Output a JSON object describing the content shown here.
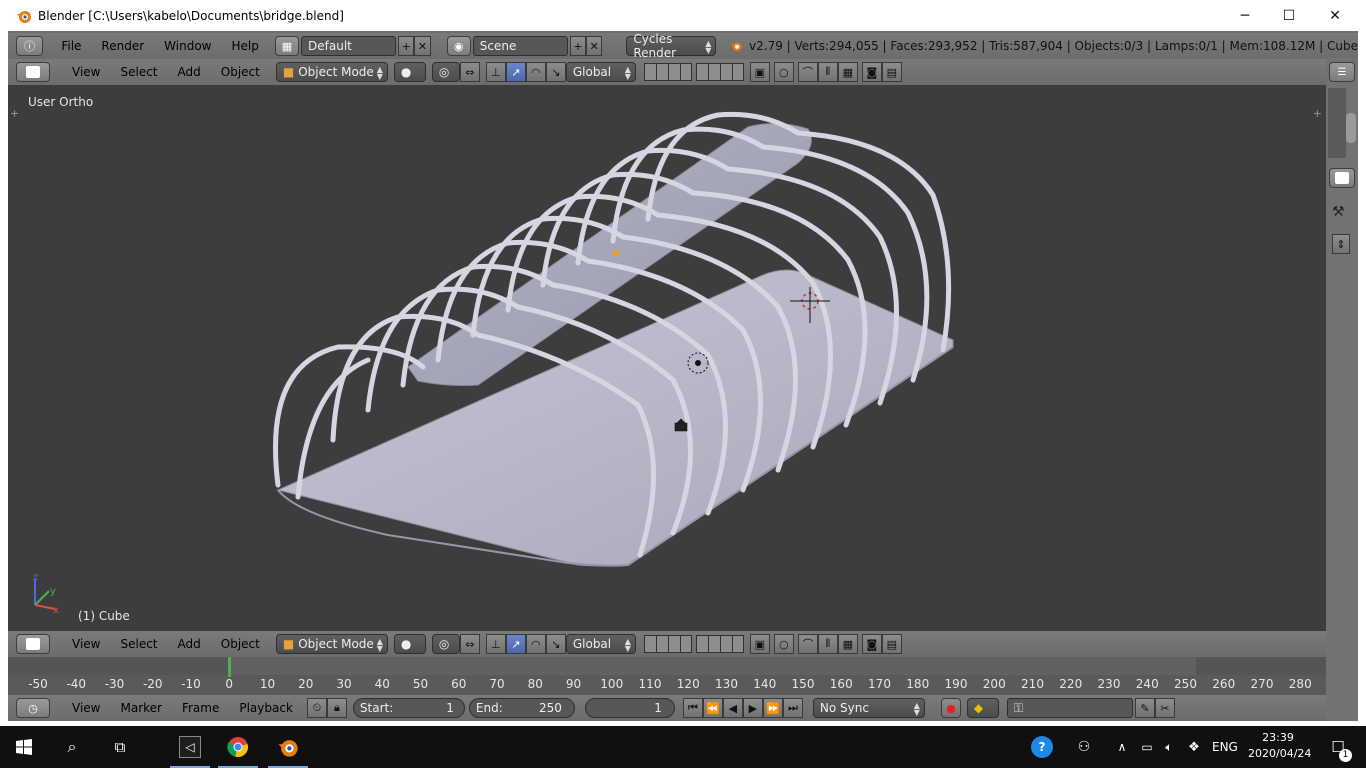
{
  "window": {
    "title": "Blender [C:\\Users\\kabelo\\Documents\\bridge.blend]",
    "minimize_glyph": "─",
    "maximize_glyph": "☐",
    "close_glyph": "✕"
  },
  "info_header": {
    "menus": [
      "File",
      "Render",
      "Window",
      "Help"
    ],
    "screen_layout": "Default",
    "scene": "Scene",
    "render_engine": "Cycles Render",
    "stats": "v2.79 | Verts:294,055 | Faces:293,952 | Tris:587,904 | Objects:0/3 | Lamps:0/1 | Mem:108.12M | Cube"
  },
  "view3d_header": {
    "menus": [
      "View",
      "Select",
      "Add",
      "Object"
    ],
    "mode": "Object Mode",
    "orientation": "Global"
  },
  "viewport": {
    "view_label": "User Ortho",
    "object_label": "(1) Cube",
    "axis_labels": {
      "x": "x",
      "y": "y",
      "z": "z"
    },
    "background_color": "#3d3d3d",
    "mesh_color": "#b9b9c8"
  },
  "timeline_header": {
    "menus": [
      "View",
      "Marker",
      "Frame",
      "Playback"
    ],
    "start_label": "Start:",
    "start_value": "1",
    "end_label": "End:",
    "end_value": "250",
    "current_frame": "1",
    "sync": "No Sync"
  },
  "timeline_ruler": {
    "ticks": [
      "-50",
      "-40",
      "-30",
      "-20",
      "-10",
      "0",
      "10",
      "20",
      "30",
      "40",
      "50",
      "60",
      "70",
      "80",
      "90",
      "100",
      "110",
      "120",
      "130",
      "140",
      "150",
      "160",
      "170",
      "180",
      "190",
      "200",
      "210",
      "220",
      "230",
      "240",
      "250",
      "260",
      "270",
      "280"
    ],
    "current_frame": 0
  },
  "taskbar": {
    "time": "23:39",
    "date": "2020/04/24",
    "language": "ENG",
    "notifications": "1"
  }
}
